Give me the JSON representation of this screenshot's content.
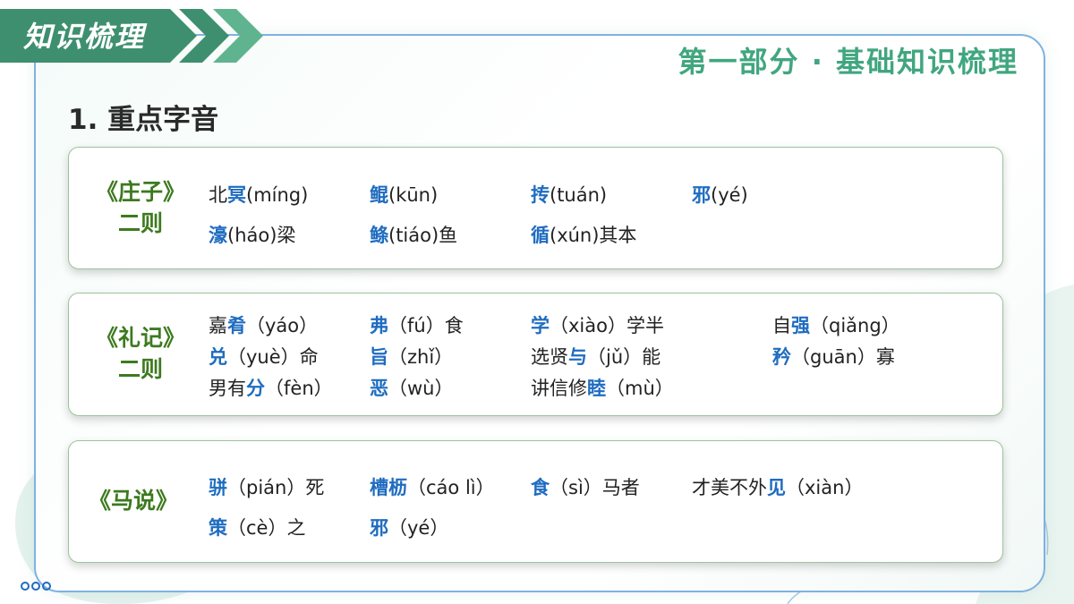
{
  "header": {
    "badge": "知识梳理",
    "part_title": "第一部分 · 基础知识梳理"
  },
  "section": {
    "heading": "1. 重点字音"
  },
  "colors": {
    "accent_green": "#41a67f",
    "badge_green": "#3e8f6f",
    "title_green": "#3d7a1f",
    "highlight_blue": "#1f6cc0",
    "frame_blue": "#7fb2e0"
  },
  "cards": {
    "zhuangzi": {
      "title_line1": "《庄子》",
      "title_line2": "二则",
      "entries": [
        {
          "pre": "北",
          "hl": "冥",
          "post": "(míng)"
        },
        {
          "pre": "",
          "hl": "鲲",
          "post": "(kūn)"
        },
        {
          "pre": "",
          "hl": "抟",
          "post": "(tuán)"
        },
        {
          "pre": "",
          "hl": "邪",
          "post": "(yé)"
        },
        {
          "pre": "",
          "hl": "濠",
          "post": "(háo)梁"
        },
        {
          "pre": "",
          "hl": "鲦",
          "post": "(tiáo)鱼"
        },
        {
          "pre": "",
          "hl": "循",
          "post": "(xún)其本"
        }
      ]
    },
    "liji": {
      "title_line1": "《礼记》",
      "title_line2": "二则",
      "entries": [
        {
          "pre": "嘉",
          "hl": "肴",
          "post": "（yáo）"
        },
        {
          "pre": "",
          "hl": "弗",
          "post": "（fú）食"
        },
        {
          "pre": "",
          "hl": "学",
          "post": "（xiào）学半"
        },
        {
          "pre": "自",
          "hl": "强",
          "post": "（qiǎng）"
        },
        {
          "pre": "",
          "hl": "兑",
          "post": "（yuè）命"
        },
        {
          "pre": "",
          "hl": "旨",
          "post": "（zhǐ）"
        },
        {
          "pre": "选贤",
          "hl": "与",
          "post": "（jǔ）能"
        },
        {
          "pre": "",
          "hl": "矜",
          "post": "（guān）寡"
        },
        {
          "pre": "男有",
          "hl": "分",
          "post": "（fèn）"
        },
        {
          "pre": "",
          "hl": "恶",
          "post": "（wù）"
        },
        {
          "pre": "讲信修",
          "hl": "睦",
          "post": "（mù）"
        }
      ]
    },
    "mashuo": {
      "title_line1": "《马说》",
      "entries": [
        {
          "pre": "",
          "hl": "骈",
          "post": "（pián）死"
        },
        {
          "pre": "",
          "hl": "槽枥",
          "post": "（cáo lì）"
        },
        {
          "pre": "",
          "hl": "食",
          "post": "（sì）马者"
        },
        {
          "pre": "才美不外",
          "hl": "见",
          "post": "（xiàn）"
        },
        {
          "pre": "",
          "hl": "策",
          "post": "（cè）之"
        },
        {
          "pre": "",
          "hl": "邪",
          "post": "（yé）"
        }
      ]
    }
  }
}
